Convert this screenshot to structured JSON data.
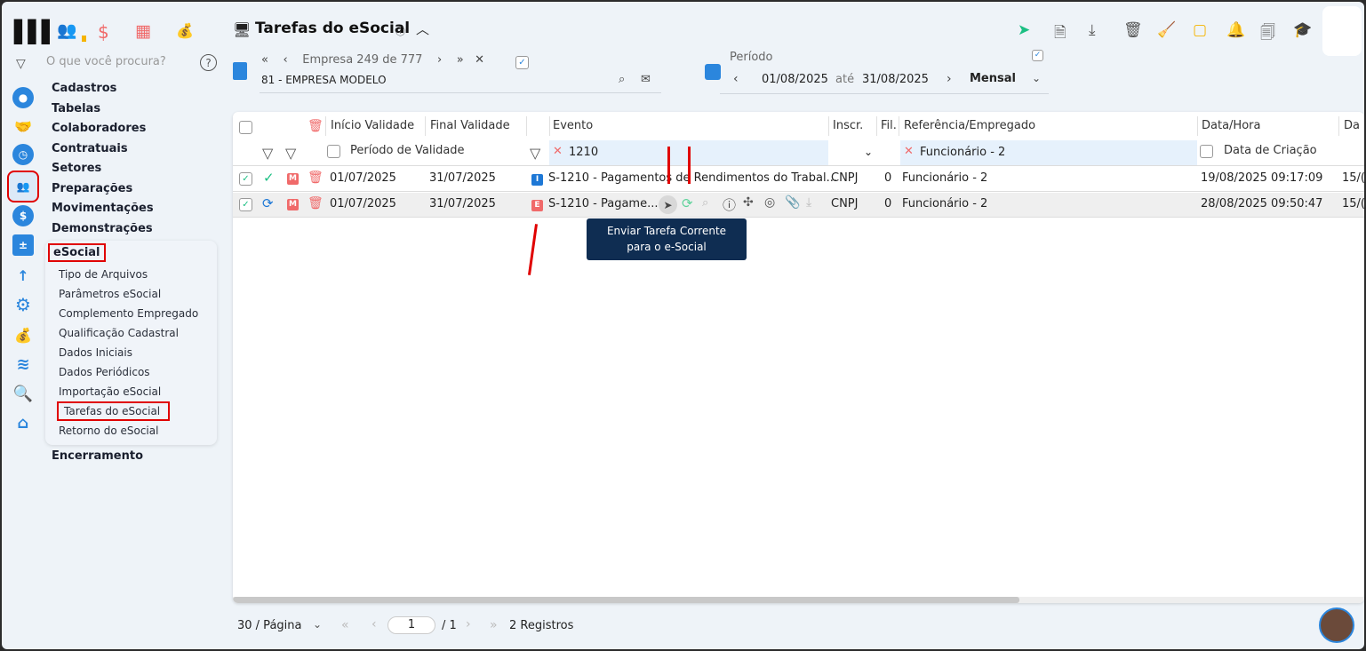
{
  "app": {
    "title": "Tarefas do eSocial",
    "search_placeholder": "O que você procura?"
  },
  "company_nav": {
    "label": "Empresa 249 de 777",
    "company": "81 - EMPRESA MODELO"
  },
  "period": {
    "label": "Período",
    "start": "01/08/2025",
    "sep": "até",
    "end": "31/08/2025",
    "mode": "Mensal"
  },
  "menu": {
    "items": [
      "Cadastros",
      "Tabelas",
      "Colaboradores",
      "Contratuais",
      "Setores",
      "Preparações",
      "Movimentações",
      "Demonstrações"
    ],
    "esocial": "eSocial",
    "sub": [
      "Tipo de Arquivos",
      "Parâmetros eSocial",
      "Complemento Empregado",
      "Qualificação Cadastral",
      "Dados Iniciais",
      "Dados Periódicos",
      "Importação eSocial",
      "Tarefas do eSocial",
      "Retorno do eSocial"
    ],
    "last": "Encerramento"
  },
  "table": {
    "headers": [
      "Início Validade",
      "Final Validade",
      "Evento",
      "Inscr.",
      "Fil.",
      "Referência/Empregado",
      "Data/Hora",
      "Da"
    ],
    "filters": {
      "periodo": "Período de Validade",
      "evento": "1210",
      "referencia": "Funcionário - 2",
      "data": "Data de Criação"
    },
    "rows": [
      {
        "badge": "I",
        "inicio": "01/07/2025",
        "final": "31/07/2025",
        "evento": "S-1210 - Pagamentos de Rendimentos do Trabal...",
        "inscr": "CNPJ",
        "fil": "0",
        "ref": "Funcionário - 2",
        "datahora": "19/08/2025 09:17:09",
        "da": "15/("
      },
      {
        "badge": "E",
        "inicio": "01/07/2025",
        "final": "31/07/2025",
        "evento": "S-1210 - Pagame...",
        "inscr": "CNPJ",
        "fil": "0",
        "ref": "Funcionário - 2",
        "datahora": "28/08/2025 09:50:47",
        "da": "15/("
      }
    ],
    "tooltip": "Enviar Tarefa Corrente para o e-Social"
  },
  "pager": {
    "per_page": "30 / Página",
    "page": "1",
    "total": "/ 1",
    "records": "2 Registros"
  },
  "colors": {
    "accent": "#2b86dd",
    "tooltip": "#0f2d52",
    "highlight": "#e00000",
    "filter_bg": "#e6f1fc"
  }
}
